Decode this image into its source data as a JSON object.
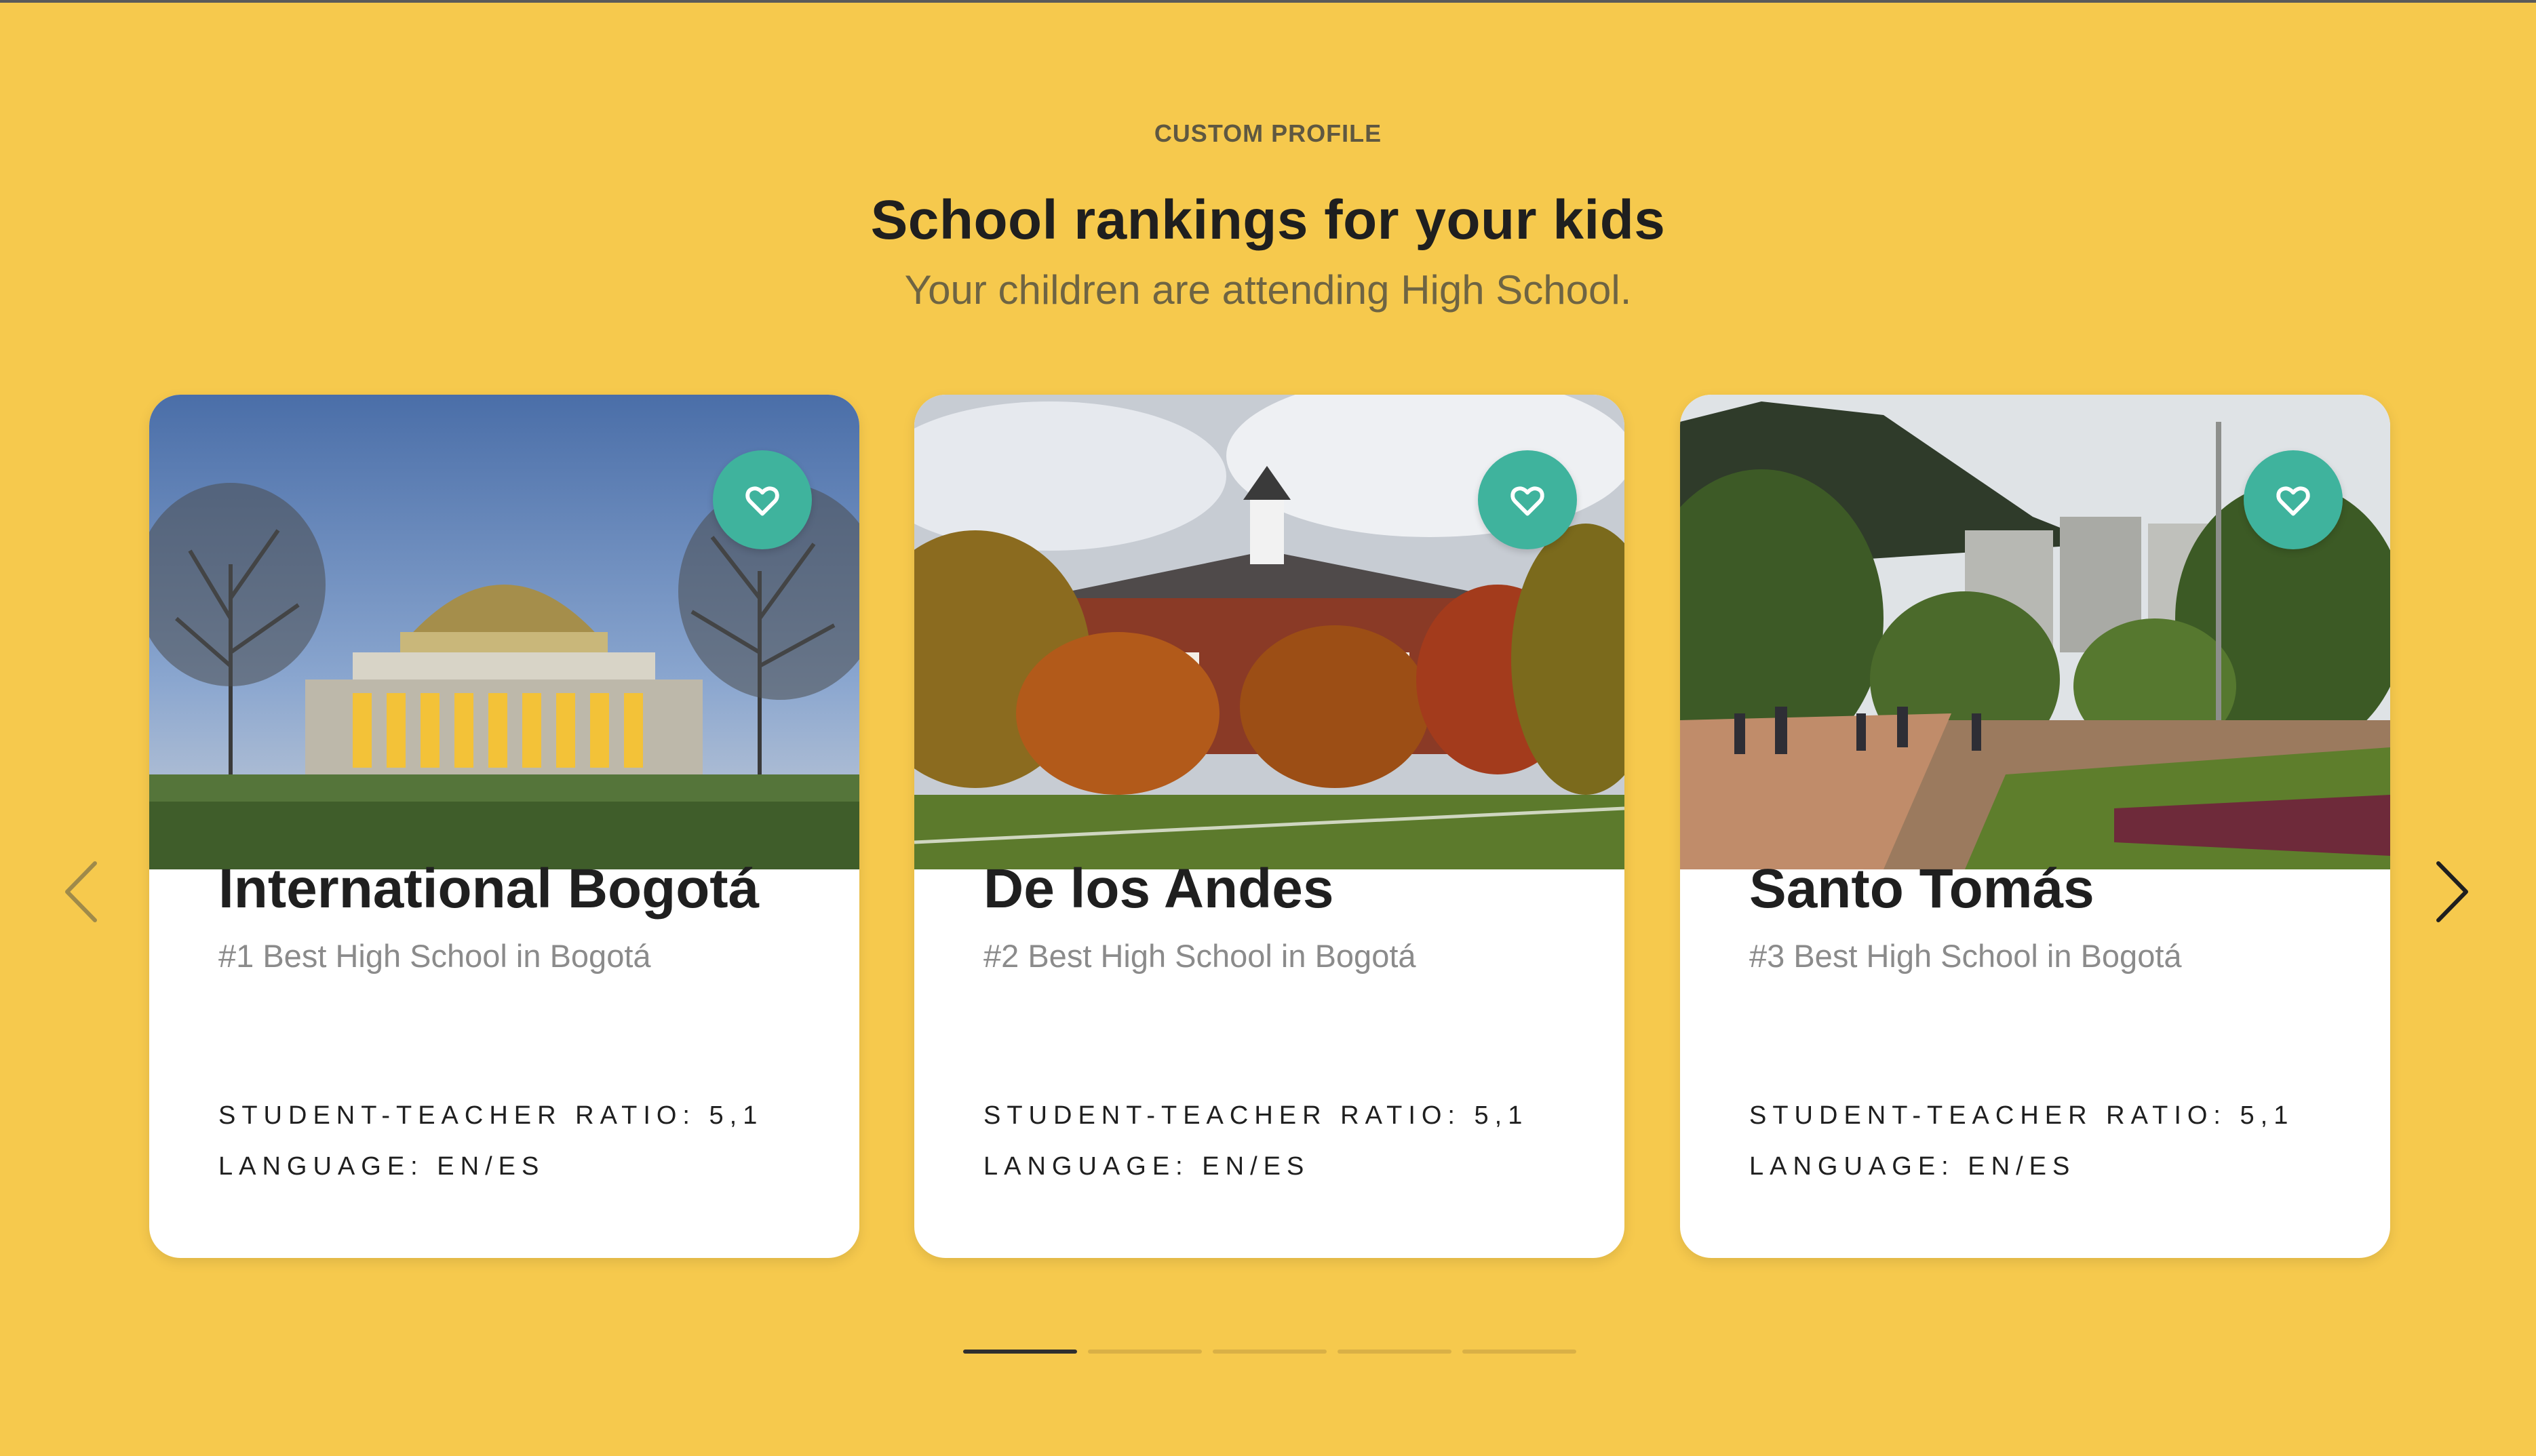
{
  "header": {
    "eyebrow": "CUSTOM PROFILE",
    "title": "School rankings for your kids",
    "subtitle": "Your children are attending High School."
  },
  "cards": [
    {
      "name": "International Bogotá",
      "rank": "#1 Best High School in Bogotá",
      "ratio": "STUDENT-TEACHER RATIO: 5,1",
      "language": "LANGUAGE: EN/ES",
      "image": "domed-campus-building-photo"
    },
    {
      "name": "De los Andes",
      "rank": "#2 Best High School in Bogotá",
      "ratio": "STUDENT-TEACHER RATIO: 5,1",
      "language": "LANGUAGE: EN/ES",
      "image": "brick-hall-autumn-trees-photo"
    },
    {
      "name": "Santo Tomás",
      "rank": "#3 Best High School in Bogotá",
      "ratio": "STUDENT-TEACHER RATIO: 5,1",
      "language": "LANGUAGE: EN/ES",
      "image": "campus-plaza-mountains-photo"
    }
  ],
  "carousel": {
    "prev_icon": "chevron-left-icon",
    "next_icon": "chevron-right-icon",
    "pages": 5,
    "active_page": 1
  },
  "colors": {
    "background": "#F6C94D",
    "accent": "#3FB39D",
    "card": "#FFFFFF"
  }
}
